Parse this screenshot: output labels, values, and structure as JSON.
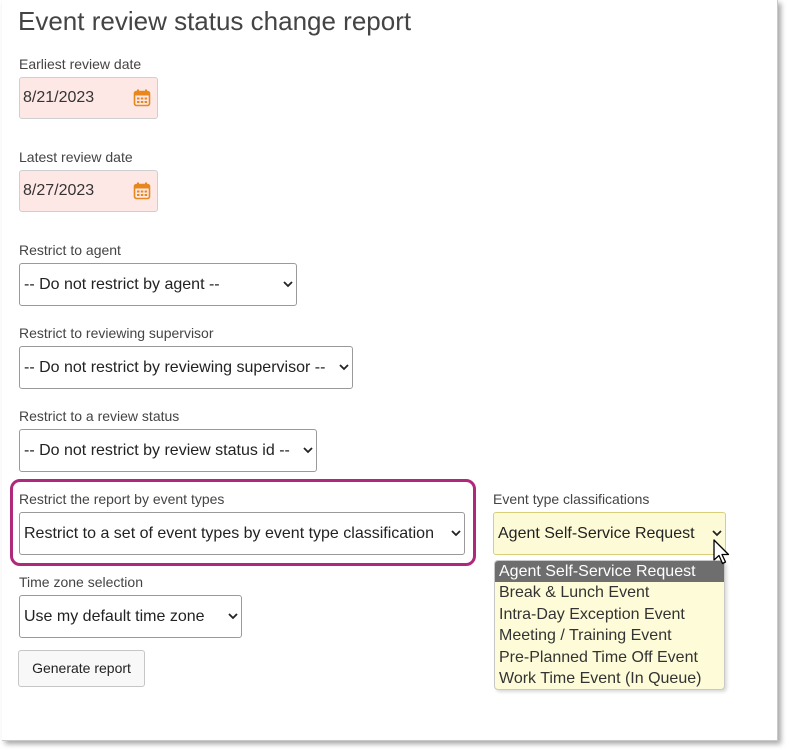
{
  "page": {
    "title": "Event review status change report"
  },
  "earliest": {
    "label": "Earliest review date",
    "value": "8/21/2023",
    "icon": "calendar-icon"
  },
  "latest": {
    "label": "Latest review date",
    "value": "8/27/2023",
    "icon": "calendar-icon"
  },
  "agent": {
    "label": "Restrict to agent",
    "value": "-- Do not restrict by agent --"
  },
  "supervisor": {
    "label": "Restrict to reviewing supervisor",
    "value": "-- Do not restrict by reviewing supervisor --"
  },
  "status": {
    "label": "Restrict to a review status",
    "value": "-- Do not restrict by review status id --"
  },
  "event_types": {
    "label": "Restrict the report by event types",
    "value": "Restrict to a set of event types by event type classification"
  },
  "classifications": {
    "label": "Event type classifications",
    "value": "Agent Self-Service Request",
    "options": [
      "Agent Self-Service Request",
      "Break & Lunch Event",
      "Intra-Day Exception Event",
      "Meeting / Training Event",
      "Pre-Planned Time Off Event",
      "Work Time Event (In Queue)"
    ]
  },
  "timezone": {
    "label": "Time zone selection",
    "value": "Use my default time zone"
  },
  "actions": {
    "generate_label": "Generate report"
  },
  "colors": {
    "highlight": "#b0287c",
    "date_bg": "#fde8e6",
    "calendar_icon": "#e8871e",
    "dropdown_bg": "#fefcd8"
  }
}
